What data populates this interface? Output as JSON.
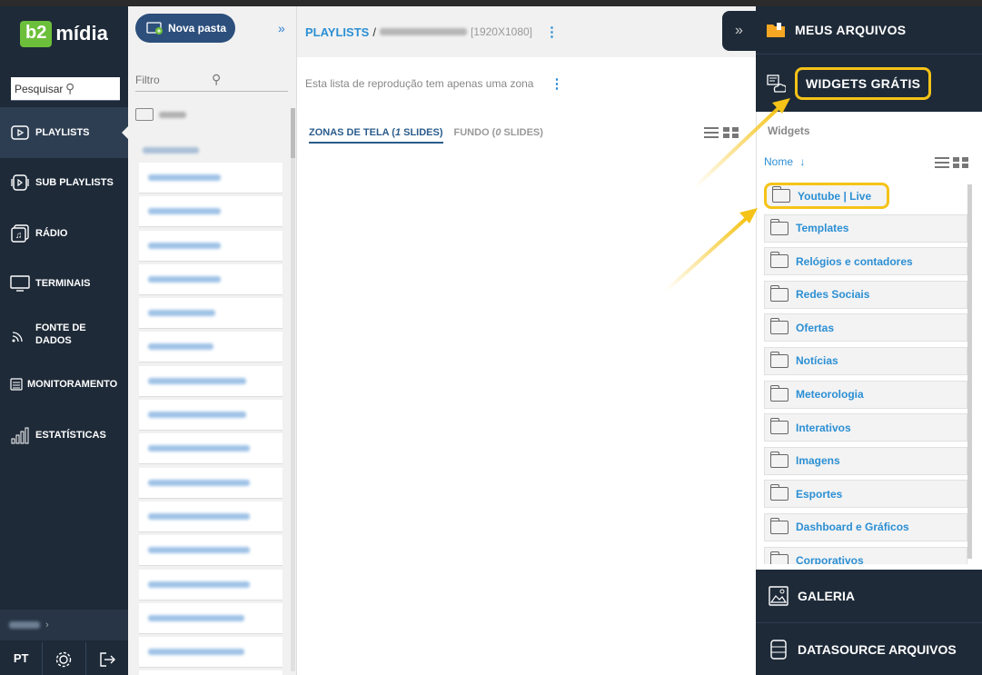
{
  "brand": {
    "logo_badge": "b2",
    "logo_text": "mídia",
    "accent_color": "#6cbf3a",
    "nav_bg": "#1e2a38"
  },
  "nav": {
    "search_placeholder": "Pesquisar",
    "items": [
      {
        "label": "PLAYLISTS",
        "icon": "play-icon",
        "active": true
      },
      {
        "label": "SUB PLAYLISTS",
        "icon": "sub-playlists-icon"
      },
      {
        "label": "RÁDIO",
        "icon": "radio-icon"
      },
      {
        "label": "TERMINAIS",
        "icon": "monitor-icon"
      },
      {
        "label": "FONTE DE DADOS",
        "icon": "rss-icon"
      },
      {
        "label": "MONITORAMENTO",
        "icon": "monitoring-icon"
      },
      {
        "label": "ESTATÍSTICAS",
        "icon": "bar-chart-icon"
      }
    ],
    "language": "PT"
  },
  "folders": {
    "new_folder_label": "Nova pasta",
    "filter_placeholder": "Filtro"
  },
  "main": {
    "breadcrumb_link": "PLAYLISTS",
    "breadcrumb_sep": "/",
    "resolution": "[1920X1080]",
    "message": "Esta lista de reprodução tem apenas uma zona",
    "tabs": [
      {
        "label": "ZONAS DE TELA (",
        "count": "1",
        "suffix": " SLIDES)",
        "active": true
      },
      {
        "label": "FUNDO (",
        "count": "0",
        "suffix": " SLIDES)",
        "active": false
      }
    ]
  },
  "right_panel": {
    "meus_arquivos": "MEUS ARQUIVOS",
    "widgets_gratis": "WIDGETS GRÁTIS",
    "crumb": "Widgets",
    "sort_label": "Nome",
    "folders": [
      "Youtube | Live",
      "Templates",
      "Relógios e contadores",
      "Redes Sociais",
      "Ofertas",
      "Notícias",
      "Meteorologia",
      "Interativos",
      "Imagens",
      "Esportes",
      "Dashboard e Gráficos",
      "Corporativos"
    ],
    "galeria": "GALERIA",
    "datasource": "DATASOURCE ARQUIVOS",
    "highlight_color": "#f5c317"
  }
}
